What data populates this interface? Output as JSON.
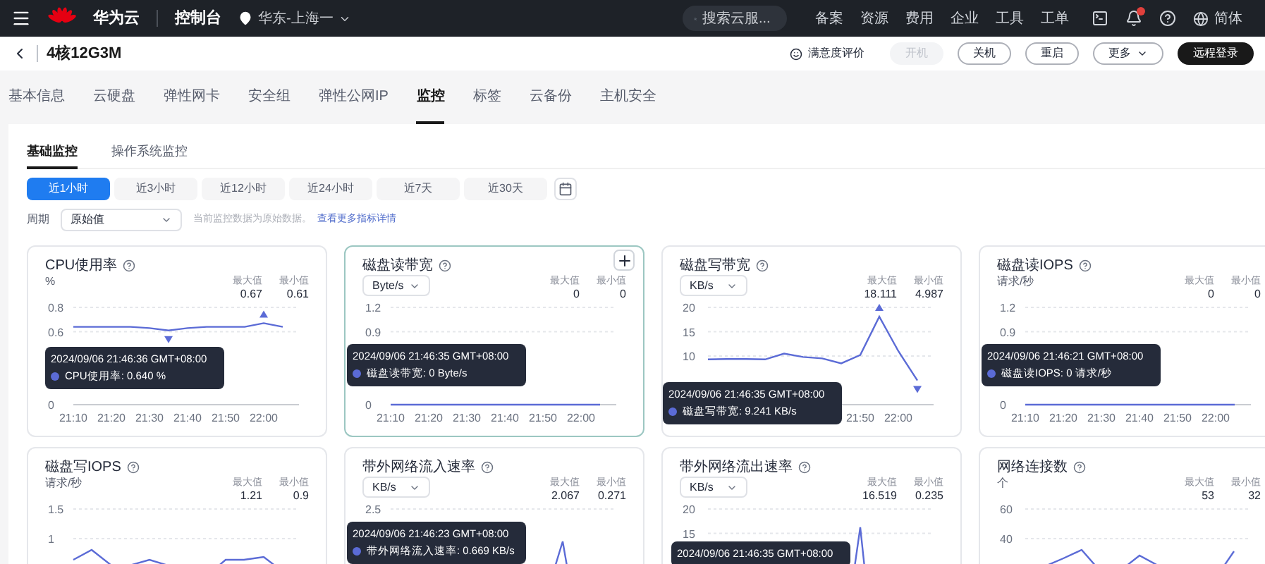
{
  "topbar": {
    "brand": "华为云",
    "console": "控制台",
    "region": "华东-上海一",
    "search": {
      "placeholder": "搜索云服..."
    },
    "nav": [
      "备案",
      "资源",
      "费用",
      "企业",
      "工具",
      "工单"
    ],
    "notification_dot": true,
    "language": "简体"
  },
  "header": {
    "title": "4核12G3M",
    "feedback": "满意度评价",
    "buttons": [
      {
        "label": "开机",
        "kind": "disabled"
      },
      {
        "label": "关机",
        "kind": "outline"
      },
      {
        "label": "重启",
        "kind": "outline"
      },
      {
        "label": "更多",
        "kind": "menu"
      },
      {
        "label": "远程登录",
        "kind": "primary"
      }
    ]
  },
  "tabs": [
    {
      "label": "基本信息",
      "selected": false
    },
    {
      "label": "云硬盘",
      "selected": false
    },
    {
      "label": "弹性网卡",
      "selected": false
    },
    {
      "label": "安全组",
      "selected": false
    },
    {
      "label": "弹性公网IP",
      "selected": false
    },
    {
      "label": "监控",
      "selected": true
    },
    {
      "label": "标签",
      "selected": false
    },
    {
      "label": "云备份",
      "selected": false
    },
    {
      "label": "主机安全",
      "selected": false
    }
  ],
  "subtabs": [
    {
      "label": "基础监控",
      "selected": true
    },
    {
      "label": "操作系统监控",
      "selected": false
    }
  ],
  "ranges": [
    {
      "label": "近1小时",
      "selected": true
    },
    {
      "label": "近3小时",
      "selected": false
    },
    {
      "label": "近12小时",
      "selected": false
    },
    {
      "label": "近24小时",
      "selected": false
    },
    {
      "label": "近7天",
      "selected": false
    },
    {
      "label": "近30天",
      "selected": false
    }
  ],
  "period": {
    "label": "周期",
    "value": "原始值",
    "hint": "当前监控数据为原始数据。",
    "link": "查看更多指标详情"
  },
  "cards": [
    {
      "title": "CPU使用率",
      "unit": {
        "kind": "text",
        "label": "%"
      },
      "hovered": false,
      "max_label": "最大值",
      "max": "0.67",
      "min_label": "最小值",
      "min": "0.61",
      "tooltip": [
        "2024/09/06 21:46:36 GMT+08:00",
        "CPU使用率: 0.640 %"
      ],
      "chart_data": {
        "type": "line",
        "categories": [
          "21:10",
          null,
          "21:20",
          null,
          "21:30",
          null,
          "21:40",
          null,
          "21:50",
          null,
          "22:00",
          null
        ],
        "ylim": [
          0,
          0.8
        ],
        "yticks": [
          0,
          0.6,
          0.8
        ],
        "series": [
          {
            "color": "#5b6bd6",
            "values": [
              0.64,
              0.64,
              0.64,
              0.64,
              0.63,
              0.61,
              0.63,
              0.64,
              0.64,
              0.64,
              0.67,
              0.64
            ]
          }
        ]
      }
    },
    {
      "title": "磁盘读带宽",
      "unit": {
        "kind": "select",
        "label": "Byte/s"
      },
      "hovered": true,
      "max_label": "最大值",
      "max": "0",
      "min_label": "最小值",
      "min": "0",
      "tooltip": [
        "2024/09/06 21:46:35 GMT+08:00",
        "磁盘读带宽: 0 Byte/s"
      ],
      "chart_data": {
        "type": "line",
        "categories": [
          "21:10",
          null,
          "21:20",
          null,
          "21:30",
          null,
          "21:40",
          null,
          "21:50",
          null,
          "22:00",
          null
        ],
        "ylim": [
          0,
          1.2
        ],
        "yticks": [
          0,
          0.9,
          1.2
        ],
        "series": [
          {
            "color": "#5b6bd6",
            "values": [
              0,
              0,
              0,
              0,
              0,
              0,
              0,
              0,
              0,
              0,
              0,
              0
            ]
          }
        ]
      }
    },
    {
      "title": "磁盘写带宽",
      "unit": {
        "kind": "select",
        "label": "KB/s"
      },
      "hovered": false,
      "max_label": "最大值",
      "max": "18.111",
      "min_label": "最小值",
      "min": "4.987",
      "tooltip": [
        "2024/09/06 21:46:35 GMT+08:00",
        "磁盘写带宽: 9.241 KB/s"
      ],
      "chart_data": {
        "type": "line",
        "categories": [
          null,
          null,
          null,
          null,
          null,
          null,
          null,
          null,
          "21:50",
          null,
          "22:00",
          null
        ],
        "ylim": [
          0,
          20
        ],
        "yticks": [
          10,
          15,
          20
        ],
        "series": [
          {
            "color": "#5b6bd6",
            "values": [
              9.3,
              9.4,
              9.4,
              9.3,
              10.5,
              9.8,
              9.5,
              8.5,
              10.2,
              18.1,
              11,
              5
            ]
          }
        ]
      }
    },
    {
      "title": "磁盘读IOPS",
      "unit": {
        "kind": "text",
        "label": "请求/秒"
      },
      "hovered": false,
      "max_label": "最大值",
      "max": "0",
      "min_label": "最小值",
      "min": "0",
      "tooltip": [
        "2024/09/06 21:46:21 GMT+08:00",
        "磁盘读IOPS: 0 请求/秒"
      ],
      "chart_data": {
        "type": "line",
        "categories": [
          "21:10",
          null,
          "21:20",
          null,
          "21:30",
          null,
          "21:40",
          null,
          "21:50",
          null,
          "22:00",
          null
        ],
        "ylim": [
          0,
          1.2
        ],
        "yticks": [
          0,
          0.9,
          1.2
        ],
        "series": [
          {
            "color": "#5b6bd6",
            "values": [
              0,
              0,
              0,
              0,
              0,
              0,
              0,
              0,
              0,
              0,
              0,
              0
            ]
          }
        ]
      }
    },
    {
      "title": "磁盘写IOPS",
      "unit": {
        "kind": "text",
        "label": "请求/秒"
      },
      "hovered": false,
      "max_label": "最大值",
      "max": "1.21",
      "min_label": "最小值",
      "min": "0.9",
      "ytick_labels": [
        "1.5",
        "1"
      ]
    },
    {
      "title": "带外网络流入速率",
      "unit": {
        "kind": "select",
        "label": "KB/s"
      },
      "hovered": false,
      "max_label": "最大值",
      "max": "2.067",
      "min_label": "最小值",
      "min": "0.271",
      "tooltip": [
        "2024/09/06 21:46:23 GMT+08:00",
        "带外网络流入速率: 0.669 KB/s"
      ],
      "ytick_labels": [
        "2.5"
      ]
    },
    {
      "title": "带外网络流出速率",
      "unit": {
        "kind": "select",
        "label": "KB/s"
      },
      "hovered": false,
      "max_label": "最大值",
      "max": "16.519",
      "min_label": "最小值",
      "min": "0.235",
      "tooltip": [
        "2024/09/06 21:46:35 GMT+08:00"
      ],
      "ytick_labels": [
        "20",
        "15"
      ]
    },
    {
      "title": "网络连接数",
      "unit": {
        "kind": "text",
        "label": "个"
      },
      "hovered": false,
      "max_label": "最大值",
      "max": "53",
      "min_label": "最小值",
      "min": "32",
      "ytick_labels": [
        "60",
        "40"
      ]
    }
  ]
}
